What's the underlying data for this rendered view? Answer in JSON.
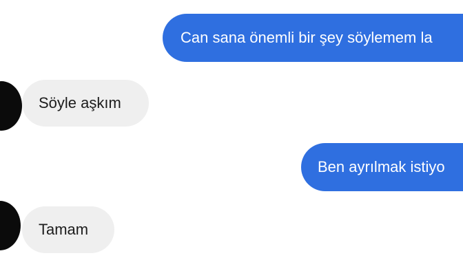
{
  "messages": [
    {
      "direction": "outgoing",
      "text": "Can sana önemli bir şey söylemem la"
    },
    {
      "direction": "incoming",
      "text": "Söyle aşkım"
    },
    {
      "direction": "outgoing",
      "text": "Ben ayrılmak istiyo"
    },
    {
      "direction": "incoming",
      "text": "Tamam"
    }
  ],
  "colors": {
    "outgoing_bubble": "#2f6fe0",
    "outgoing_text": "#ffffff",
    "incoming_bubble": "#efefef",
    "incoming_text": "#1c1c1c",
    "avatar": "#0b0b0b"
  }
}
